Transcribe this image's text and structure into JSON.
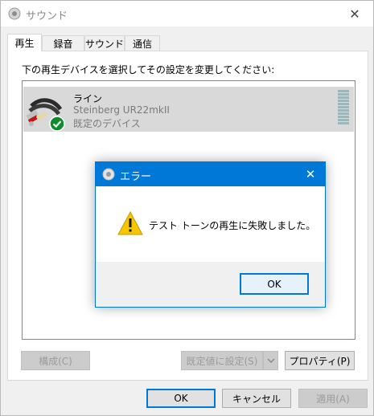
{
  "window": {
    "title": "サウンド",
    "close_glyph": "✕"
  },
  "tabs": [
    {
      "label": "再生",
      "active": true
    },
    {
      "label": "録音",
      "active": false
    },
    {
      "label": "サウンド",
      "active": false
    },
    {
      "label": "通信",
      "active": false
    }
  ],
  "playback": {
    "instruction": "下の再生デバイスを選択してその設定を変更してください:",
    "devices": [
      {
        "name": "ライン",
        "model": "Steinberg UR22mkII",
        "status": "既定のデバイス",
        "icon": "line-cable-icon",
        "badge": "default-check-icon"
      }
    ],
    "configure_label": "構成(C)",
    "set_default_label": "既定値に設定(S)",
    "properties_label": "プロパティ(P)"
  },
  "footer": {
    "ok_label": "OK",
    "cancel_label": "キャンセル",
    "apply_label": "適用(A)"
  },
  "error_dialog": {
    "title": "エラー",
    "close_glyph": "✕",
    "message": "テスト トーンの再生に失敗しました。",
    "ok_label": "OK",
    "icon": "warning-icon"
  },
  "colors": {
    "accent": "#0078d7",
    "selection": "#d9d9d9",
    "warning": "#f7c600",
    "check_badge": "#0f8a2e"
  }
}
